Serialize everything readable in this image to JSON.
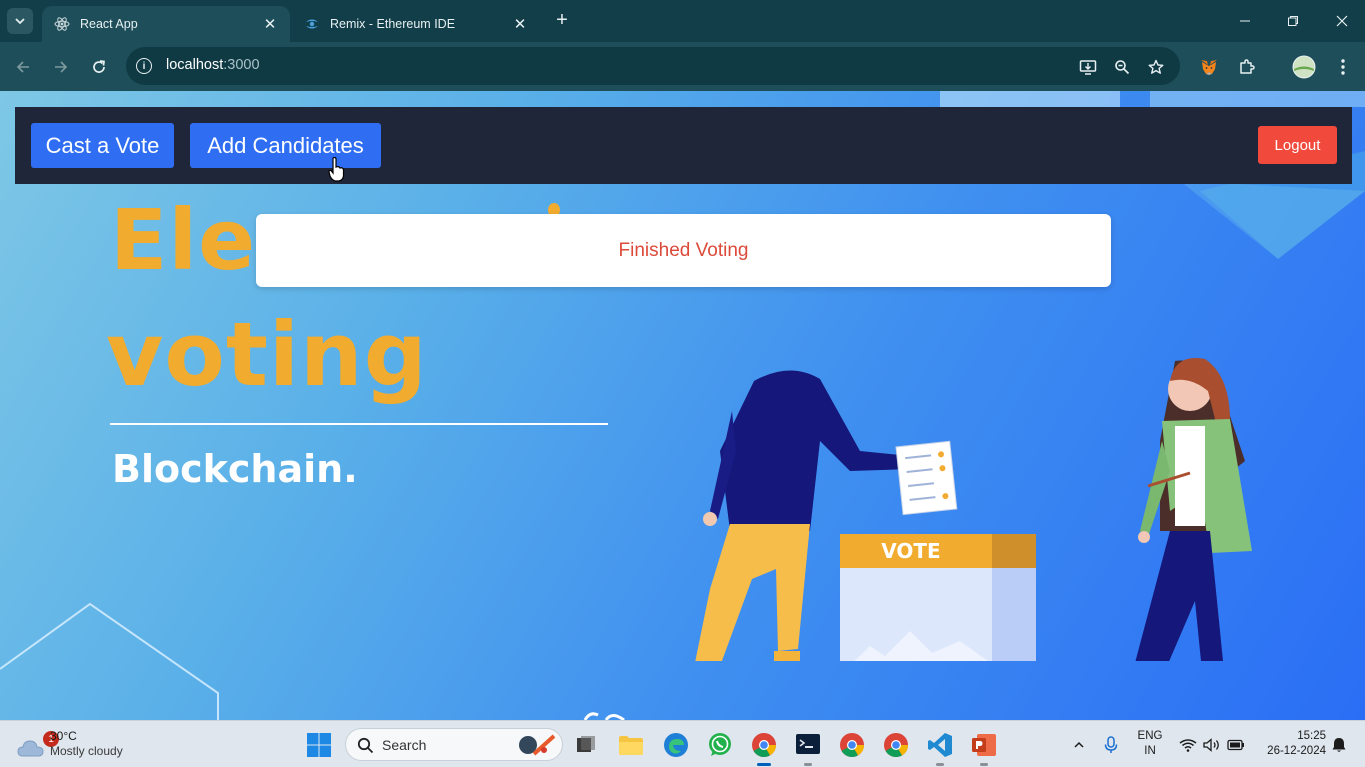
{
  "browser": {
    "tabs": [
      {
        "title": "React App",
        "active": true
      },
      {
        "title": "Remix - Ethereum IDE",
        "active": false
      }
    ],
    "url_host": "localhost",
    "url_port": ":3000"
  },
  "app": {
    "nav": {
      "cast_vote_label": "Cast a Vote",
      "add_candidates_label": "Add Candidates",
      "logout_label": "Logout"
    },
    "hero": {
      "title_line1": "Ele",
      "title_line2": "voting",
      "subtitle": "Blockchain."
    },
    "status_message": "Finished Voting",
    "ballot_box_label": "VOTE"
  },
  "taskbar": {
    "weather_badge": "1",
    "temperature": "30°C",
    "weather_condition": "Mostly cloudy",
    "search_label": "Search",
    "language_line1": "ENG",
    "language_line2": "IN",
    "time": "15:25",
    "date": "26-12-2024"
  },
  "colors": {
    "accent_blue": "#2f6ef2",
    "logout_red": "#f1493c",
    "status_text": "#dc4a3a",
    "hero_orange": "#f1ab2f"
  }
}
